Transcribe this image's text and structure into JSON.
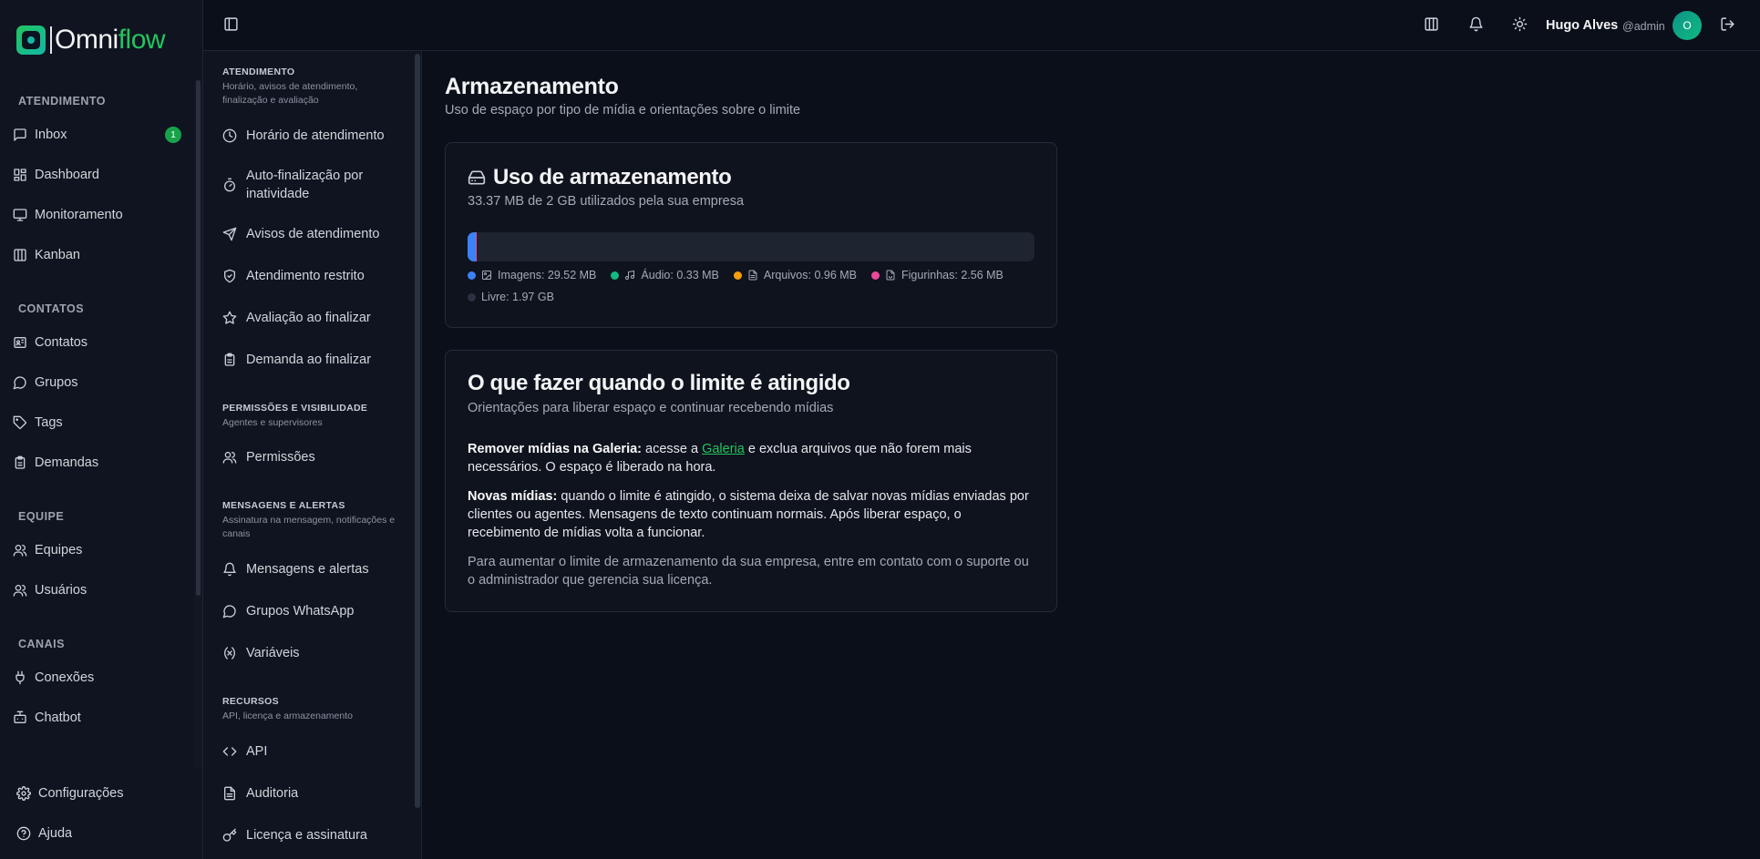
{
  "brand": {
    "name_part1": "Omni",
    "name_part2": "flow"
  },
  "sidebar": {
    "sections": [
      {
        "title": "ATENDIMENTO",
        "items": [
          {
            "label": "Inbox",
            "icon": "inbox-icon",
            "badge": "1"
          },
          {
            "label": "Dashboard",
            "icon": "dashboard-icon"
          },
          {
            "label": "Monitoramento",
            "icon": "monitor-icon"
          },
          {
            "label": "Kanban",
            "icon": "kanban-icon"
          }
        ]
      },
      {
        "title": "CONTATOS",
        "items": [
          {
            "label": "Contatos",
            "icon": "contacts-icon"
          },
          {
            "label": "Grupos",
            "icon": "chat-bubble-icon"
          },
          {
            "label": "Tags",
            "icon": "tag-icon"
          },
          {
            "label": "Demandas",
            "icon": "clipboard-icon"
          }
        ]
      },
      {
        "title": "EQUIPE",
        "items": [
          {
            "label": "Equipes",
            "icon": "users-icon"
          },
          {
            "label": "Usuários",
            "icon": "users-icon"
          }
        ]
      },
      {
        "title": "CANAIS",
        "items": [
          {
            "label": "Conexões",
            "icon": "plug-icon"
          },
          {
            "label": "Chatbot",
            "icon": "bot-icon"
          }
        ]
      }
    ],
    "bottom": [
      {
        "label": "Configurações",
        "icon": "gear-icon"
      },
      {
        "label": "Ajuda",
        "icon": "help-icon"
      }
    ]
  },
  "topbar": {
    "user_name": "Hugo Alves",
    "user_handle": "@admin",
    "avatar_initial": "O"
  },
  "subnav": {
    "groups": [
      {
        "title": "ATENDIMENTO",
        "description": "Horário, avisos de atendimento, finalização e avaliação",
        "items": [
          "Horário de atendimento",
          "Auto-finalização por inatividade",
          "Avisos de atendimento",
          "Atendimento restrito",
          "Avaliação ao finalizar",
          "Demanda ao finalizar"
        ]
      },
      {
        "title": "PERMISSÕES E VISIBILIDADE",
        "description": "Agentes e supervisores",
        "items": [
          "Permissões"
        ]
      },
      {
        "title": "MENSAGENS E ALERTAS",
        "description": "Assinatura na mensagem, notificações e canais",
        "items": [
          "Mensagens e alertas",
          "Grupos WhatsApp",
          "Variáveis"
        ]
      },
      {
        "title": "RECURSOS",
        "description": "API, licença e armazenamento",
        "items": [
          "API",
          "Auditoria",
          "Licença e assinatura"
        ]
      }
    ]
  },
  "page": {
    "title": "Armazenamento",
    "subtitle": "Uso de espaço por tipo de mídia e orientações sobre o limite"
  },
  "usage_card": {
    "title": "Uso de armazenamento",
    "subtitle": "33.37 MB de 2 GB utilizados pela sua empresa",
    "segments": [
      {
        "key": "images",
        "label": "Imagens: 29.52 MB",
        "mb": 29.52,
        "color": "#3b82f6",
        "icon": "image-icon"
      },
      {
        "key": "audio",
        "label": "Áudio: 0.33 MB",
        "mb": 0.33,
        "color": "#10b981",
        "icon": "music-icon"
      },
      {
        "key": "files",
        "label": "Arquivos: 0.96 MB",
        "mb": 0.96,
        "color": "#f59e0b",
        "icon": "file-icon"
      },
      {
        "key": "stickers",
        "label": "Figurinhas: 2.56 MB",
        "mb": 2.56,
        "color": "#ec4899",
        "icon": "sticker-icon"
      }
    ],
    "total_mb": 2048,
    "free_label": "Livre: 1.97 GB",
    "free_color": "#2a3140"
  },
  "limit_card": {
    "title": "O que fazer quando o limite é atingido",
    "subtitle": "Orientações para liberar espaço e continuar recebendo mídias",
    "p1_bold": "Remover mídias na Galeria:",
    "p1_before_link": " acesse a ",
    "p1_link": "Galeria",
    "p1_after_link": " e exclua arquivos que não forem mais necessários. O espaço é liberado na hora.",
    "p2_bold": "Novas mídias:",
    "p2_text": " quando o limite é atingido, o sistema deixa de salvar novas mídias enviadas por clientes ou agentes. Mensagens de texto continuam normais. Após liberar espaço, o recebimento de mídias volta a funcionar.",
    "p3_text": "Para aumentar o limite de armazenamento da sua empresa, entre em contato com o suporte ou o administrador que gerencia sua licença."
  },
  "colors": {
    "accent": "#22c55e",
    "badge": "#16a34a"
  }
}
